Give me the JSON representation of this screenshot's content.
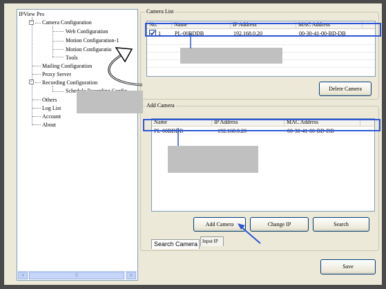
{
  "tree": {
    "root": "IPView Pro",
    "items": [
      {
        "label": "Camera Configuration",
        "level": 1,
        "expander": "−"
      },
      {
        "label": "Web Configuration",
        "level": 3
      },
      {
        "label": "Motion Configuration-1",
        "level": 3
      },
      {
        "label": "Motion Configuratio",
        "level": 3
      },
      {
        "label": "Tools",
        "level": 3
      },
      {
        "label": "Mailing Configuration",
        "level": 1
      },
      {
        "label": "Proxy Server",
        "level": 1
      },
      {
        "label": "Recording Configuration",
        "level": 1,
        "expander": "−"
      },
      {
        "label": "Schedule Recording Config",
        "level": 3
      },
      {
        "label": "Others",
        "level": 1
      },
      {
        "label": "Log List",
        "level": 1
      },
      {
        "label": "Account",
        "level": 1
      },
      {
        "label": "About",
        "level": 1
      }
    ],
    "scroll_left": "<",
    "scroll_right": ">",
    "scroll_grip": "|||"
  },
  "camera_list": {
    "title": "Camera List",
    "columns": [
      "No.",
      "Name",
      "IP Address",
      "MAC Address"
    ],
    "rows": [
      {
        "no": "1",
        "name": "PL-00BDDB",
        "ip": "192.168.0.20",
        "mac": "00-30-41-00-BD-DB",
        "checked": true
      }
    ],
    "delete_label": "Delete Camera"
  },
  "add_camera": {
    "title": "Add Camera",
    "columns": [
      "Name",
      "IP Address",
      "MAC Address"
    ],
    "rows": [
      {
        "name": "PL-00BDDB",
        "ip": "192.168.0.20",
        "mac": "00-30-41-00-BD-DB"
      }
    ],
    "add_label": "Add Camera",
    "change_ip_label": "Change IP",
    "search_label": "Search",
    "tabs": [
      "Search Camera",
      "Input IP"
    ]
  },
  "save_label": "Save",
  "colors": {
    "highlight": "#2b55d6",
    "window_bg": "#ece9d8",
    "frame": "#4a4a4a"
  }
}
